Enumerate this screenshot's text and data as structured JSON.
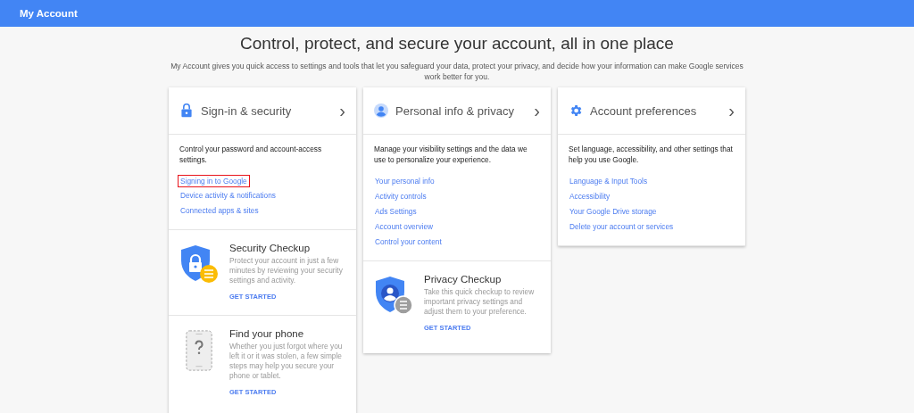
{
  "app_bar": {
    "title": "My Account"
  },
  "headline": "Control, protect, and secure your account, all in one place",
  "intro": "My Account gives you quick access to settings and tools that let you safeguard your data, protect your privacy, and decide how your information can make Google services work better for you.",
  "cards": [
    {
      "kind": "security",
      "title": "Sign-in & security",
      "chevron": "›",
      "description": "Control your password and account-access settings.",
      "links": [
        {
          "label": "Signing in to Google",
          "highlighted": true
        },
        {
          "label": "Device activity & notifications",
          "highlighted": false
        },
        {
          "label": "Connected apps & sites",
          "highlighted": false
        }
      ],
      "sections": [
        {
          "kind": "checkup",
          "title": "Security Checkup",
          "text": "Protect your account in just a few minutes by reviewing your security settings and activity.",
          "action": "GET STARTED"
        },
        {
          "kind": "device",
          "title": "Find your phone",
          "text": "Whether you just forgot where you left it or it was stolen, a few simple steps may help you secure your phone or tablet.",
          "action": "GET STARTED"
        }
      ]
    },
    {
      "kind": "privacy",
      "title": "Personal info & privacy",
      "chevron": "›",
      "description": "Manage your visibility settings and the data we use to personalize your experience.",
      "links": [
        {
          "label": "Your personal info",
          "highlighted": false
        },
        {
          "label": "Activity controls",
          "highlighted": false
        },
        {
          "label": "Ads Settings",
          "highlighted": false
        },
        {
          "label": "Account overview",
          "highlighted": false
        },
        {
          "label": "Control your content",
          "highlighted": false
        }
      ],
      "sections": [
        {
          "kind": "privacy-checkup",
          "title": "Privacy Checkup",
          "text": "Take this quick checkup to review important privacy settings and adjust them to your preference.",
          "action": "GET STARTED"
        }
      ]
    },
    {
      "kind": "preferences",
      "title": "Account preferences",
      "chevron": "›",
      "description": "Set language, accessibility, and other settings that help you use Google.",
      "links": [
        {
          "label": "Language & Input Tools",
          "highlighted": false
        },
        {
          "label": "Accessibility",
          "highlighted": false
        },
        {
          "label": "Your Google Drive storage",
          "highlighted": false
        },
        {
          "label": "Delete your account or services",
          "highlighted": false
        }
      ]
    }
  ]
}
